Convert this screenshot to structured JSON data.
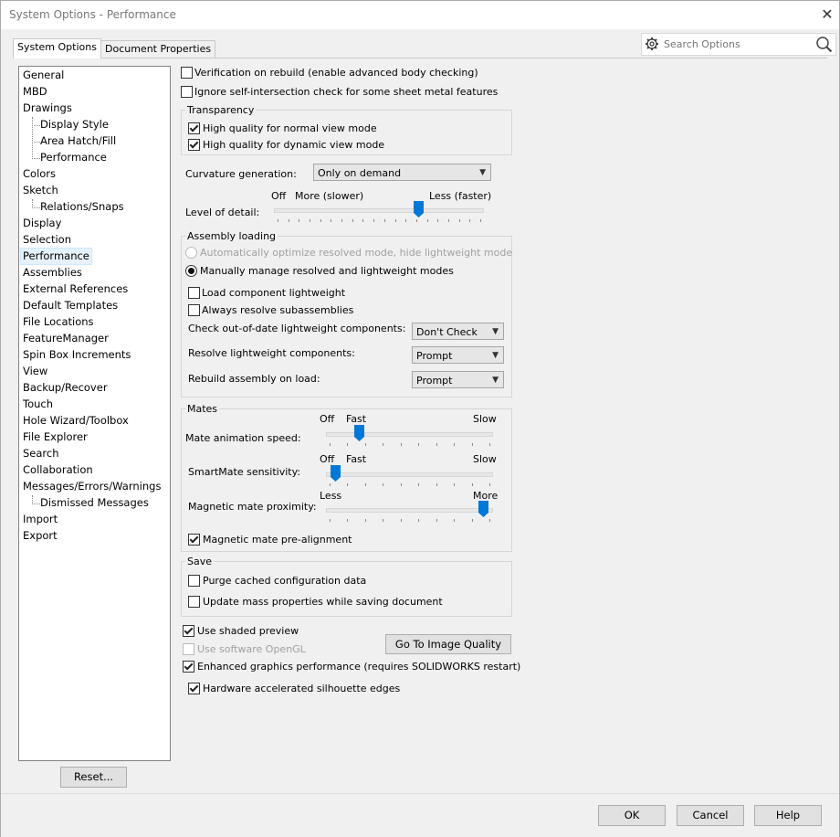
{
  "window": {
    "title": "System Options - Performance",
    "close": "✕"
  },
  "tabs": [
    {
      "label": "System Options"
    },
    {
      "label": "Document Properties"
    }
  ],
  "search": {
    "placeholder": "Search Options"
  },
  "nav": {
    "items": [
      {
        "label": "General",
        "level": 0
      },
      {
        "label": "MBD",
        "level": 0
      },
      {
        "label": "Drawings",
        "level": 0
      },
      {
        "label": "Display Style",
        "level": 1
      },
      {
        "label": "Area Hatch/Fill",
        "level": 1
      },
      {
        "label": "Performance",
        "level": 1
      },
      {
        "label": "Colors",
        "level": 0
      },
      {
        "label": "Sketch",
        "level": 0
      },
      {
        "label": "Relations/Snaps",
        "level": 1
      },
      {
        "label": "Display",
        "level": 0
      },
      {
        "label": "Selection",
        "level": 0
      },
      {
        "label": "Performance",
        "level": 0,
        "selected": true
      },
      {
        "label": "Assemblies",
        "level": 0
      },
      {
        "label": "External References",
        "level": 0
      },
      {
        "label": "Default Templates",
        "level": 0
      },
      {
        "label": "File Locations",
        "level": 0
      },
      {
        "label": "FeatureManager",
        "level": 0
      },
      {
        "label": "Spin Box Increments",
        "level": 0
      },
      {
        "label": "View",
        "level": 0
      },
      {
        "label": "Backup/Recover",
        "level": 0
      },
      {
        "label": "Touch",
        "level": 0
      },
      {
        "label": "Hole Wizard/Toolbox",
        "level": 0
      },
      {
        "label": "File Explorer",
        "level": 0
      },
      {
        "label": "Search",
        "level": 0
      },
      {
        "label": "Collaboration",
        "level": 0
      },
      {
        "label": "Messages/Errors/Warnings",
        "level": 0
      },
      {
        "label": "Dismissed Messages",
        "level": 1
      },
      {
        "label": "Import",
        "level": 0
      },
      {
        "label": "Export",
        "level": 0
      }
    ],
    "reset_label": "Reset..."
  },
  "top": {
    "verification": {
      "label": "Verification on rebuild (enable advanced body checking)",
      "checked": false
    },
    "ignore_self": {
      "label": "Ignore self-intersection check for some sheet metal features",
      "checked": false
    }
  },
  "transparency": {
    "title": "Transparency",
    "normal": {
      "label": "High quality for normal view mode",
      "checked": true
    },
    "dynamic": {
      "label": "High quality for dynamic view mode",
      "checked": true
    }
  },
  "curvature": {
    "label": "Curvature generation:",
    "value": "Only on demand"
  },
  "lod": {
    "label": "Level of detail:",
    "off": "Off",
    "more": "More (slower)",
    "less": "Less (faster)",
    "level": 0.7
  },
  "assembly": {
    "title": "Assembly loading",
    "auto": {
      "label": "Automatically optimize resolved mode, hide lightweight mode"
    },
    "manual": {
      "label": "Manually manage resolved and lightweight modes"
    },
    "load_light": {
      "label": "Load component lightweight",
      "checked": false
    },
    "always_resolve": {
      "label": "Always resolve subassemblies",
      "checked": false
    },
    "check_ood": {
      "label": "Check out-of-date lightweight components:",
      "value": "Don't Check"
    },
    "resolve_light": {
      "label": "Resolve lightweight components:",
      "value": "Prompt"
    },
    "rebuild": {
      "label": "Rebuild assembly on load:",
      "value": "Prompt"
    }
  },
  "mates": {
    "title": "Mates",
    "anim": {
      "label": "Mate animation speed:",
      "off": "Off",
      "fast": "Fast",
      "slow": "Slow",
      "level": 0.18
    },
    "smart": {
      "label": "SmartMate sensitivity:",
      "off": "Off",
      "fast": "Fast",
      "slow": "Slow",
      "level": 0.03
    },
    "magnetic": {
      "label": "Magnetic mate proximity:",
      "less": "Less",
      "more": "More",
      "level": 0.97
    },
    "prealign": {
      "label": "Magnetic mate pre-alignment",
      "checked": true
    }
  },
  "save": {
    "title": "Save",
    "purge": {
      "label": "Purge cached configuration data",
      "checked": false
    },
    "update_mass": {
      "label": "Update mass properties while saving document",
      "checked": false
    }
  },
  "bottom": {
    "shaded": {
      "label": "Use shaded preview",
      "checked": true
    },
    "opengl": {
      "label": "Use software OpenGL",
      "checked": false
    },
    "enhanced": {
      "label": "Enhanced graphics performance (requires SOLIDWORKS restart)",
      "checked": true
    },
    "silhouette": {
      "label": "Hardware accelerated silhouette edges",
      "checked": true
    },
    "image_quality_btn": "Go To Image Quality"
  },
  "footer": {
    "ok": "OK",
    "cancel": "Cancel",
    "help": "Help"
  }
}
